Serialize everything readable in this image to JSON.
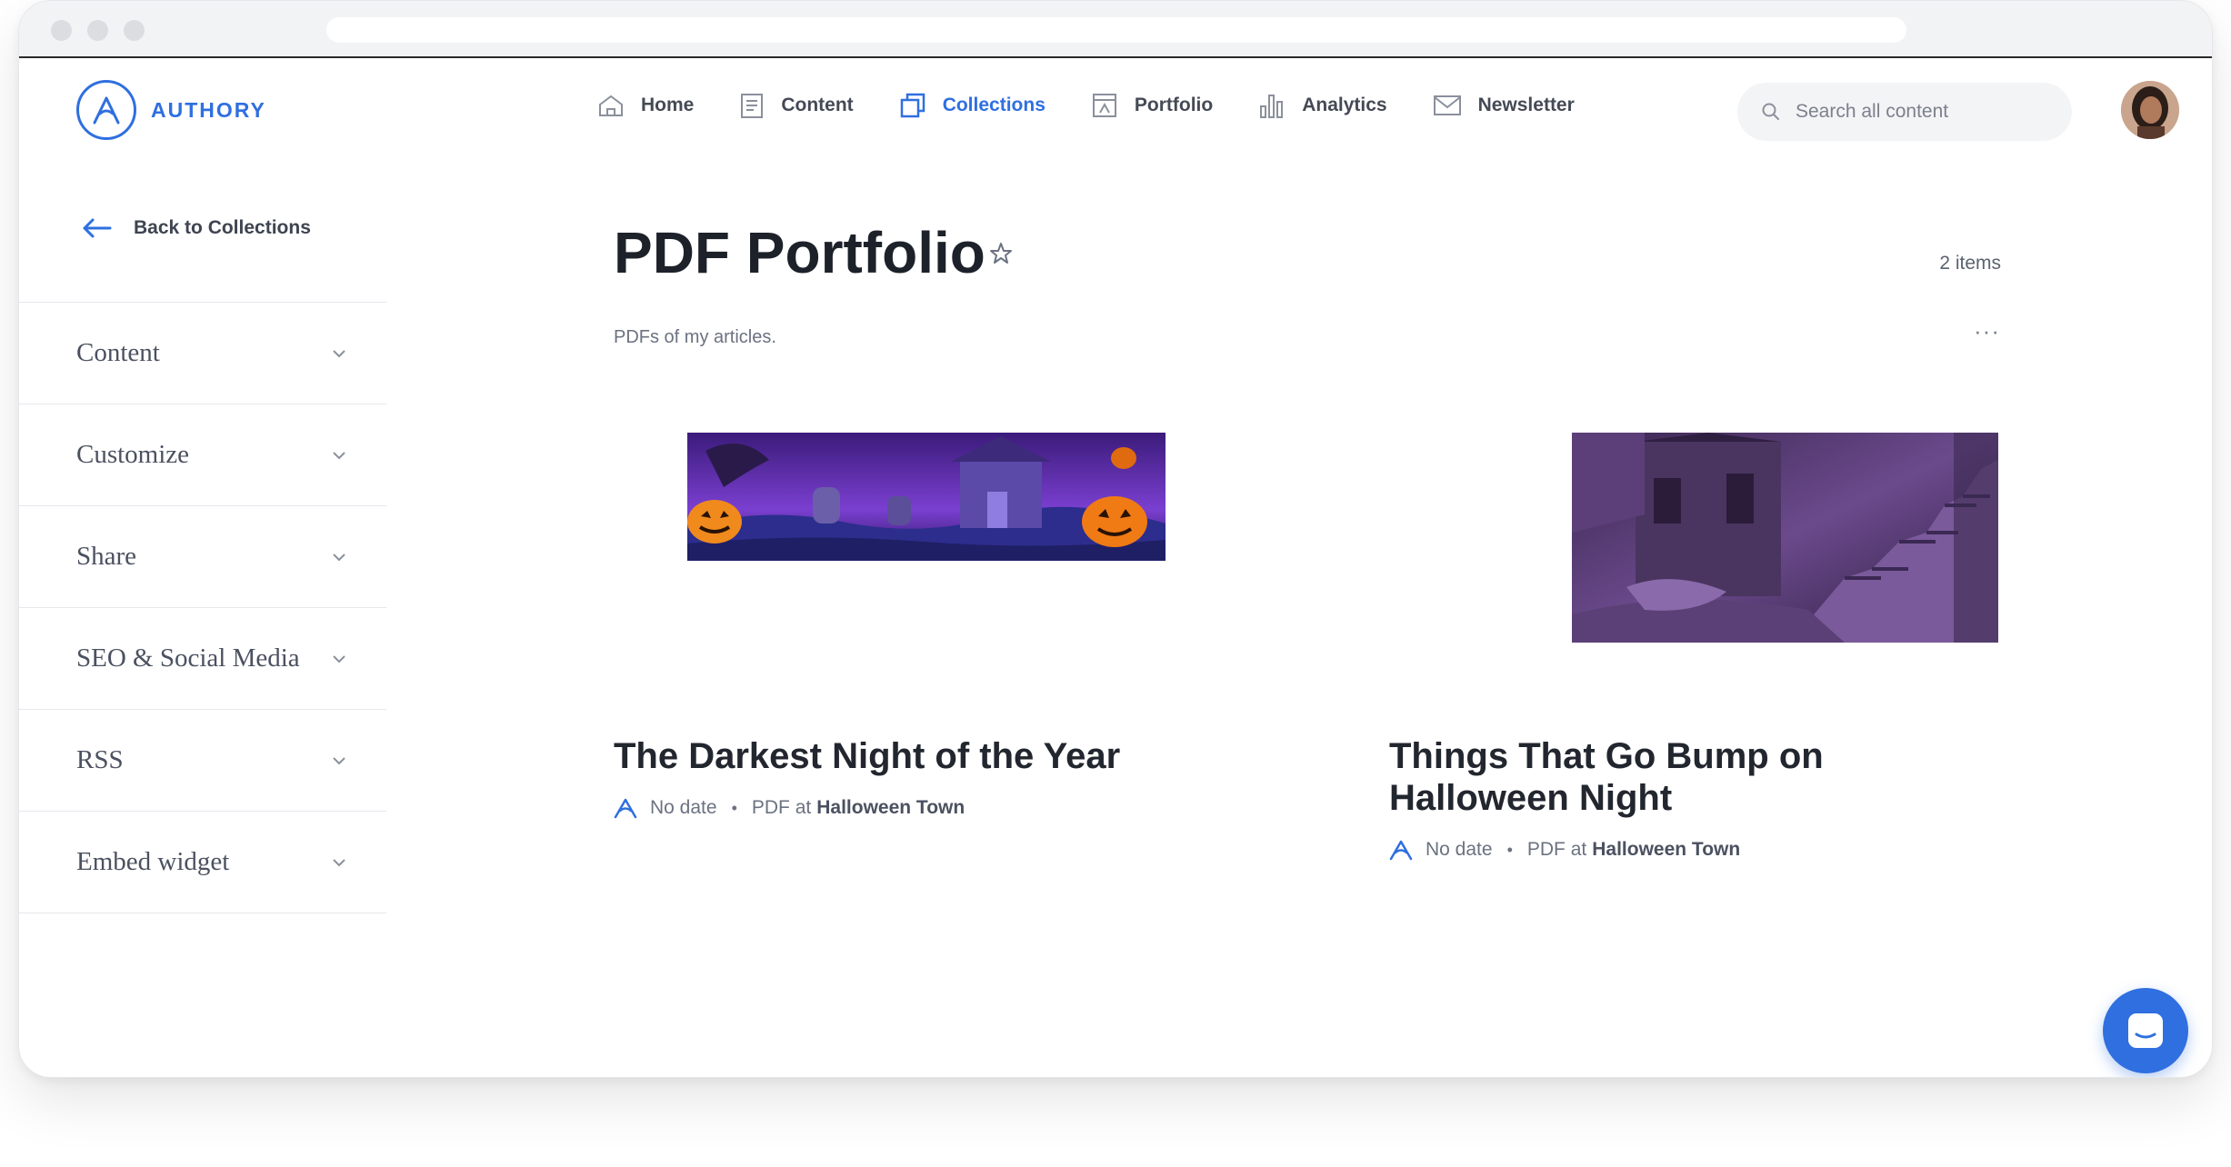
{
  "brand": {
    "name": "AUTHORY",
    "color": "#2f6fe0"
  },
  "nav": {
    "items": [
      {
        "label": "Home",
        "icon": "home-icon"
      },
      {
        "label": "Content",
        "icon": "content-icon"
      },
      {
        "label": "Collections",
        "icon": "collections-icon",
        "active": true
      },
      {
        "label": "Portfolio",
        "icon": "portfolio-icon"
      },
      {
        "label": "Analytics",
        "icon": "analytics-icon"
      },
      {
        "label": "Newsletter",
        "icon": "newsletter-icon"
      }
    ]
  },
  "search": {
    "placeholder": "Search all content"
  },
  "sidebar": {
    "back_label": "Back to Collections",
    "items": [
      {
        "label": "Content"
      },
      {
        "label": "Customize"
      },
      {
        "label": "Share"
      },
      {
        "label": "SEO & Social Media"
      },
      {
        "label": "RSS"
      },
      {
        "label": "Embed widget"
      }
    ]
  },
  "collection": {
    "title": "PDF Portfolio",
    "items_count": "2 items",
    "description": "PDFs of my articles.",
    "more": "···"
  },
  "cards": [
    {
      "title": "The Darkest Night of the Year",
      "date": "No date",
      "type": "PDF at",
      "outlet": "Halloween Town",
      "image": "halloween-graveyard-banner"
    },
    {
      "title": "Things That Go Bump on Halloween Night",
      "date": "No date",
      "type": "PDF at",
      "outlet": "Halloween Town",
      "image": "haunted-stairway-illustration"
    }
  ],
  "chat": {
    "icon": "chat-icon"
  }
}
